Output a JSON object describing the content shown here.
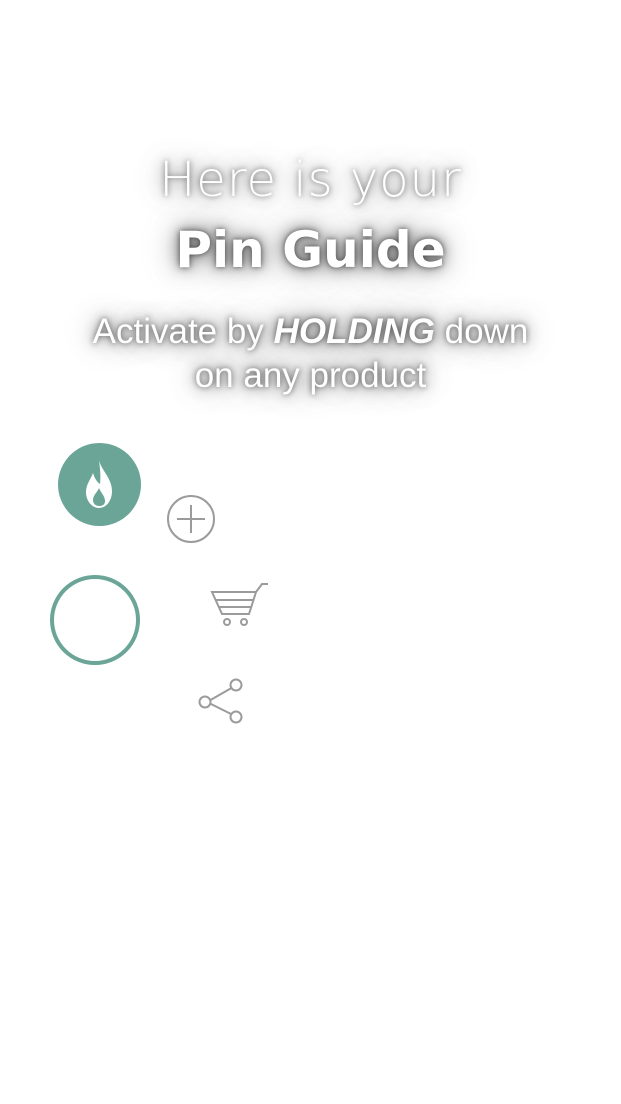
{
  "guide": {
    "title_line1": "Here is your",
    "title_line2": "Pin Guide",
    "instruction_prefix": "Activate by ",
    "instruction_emphasis": "HOLDING",
    "instruction_suffix": " down",
    "instruction_line2": "on any product"
  },
  "pin_menu": {
    "hot_button_icon": "fire-icon",
    "pin_target_icon": "ring-icon",
    "actions": [
      {
        "name": "add",
        "icon": "plus-icon"
      },
      {
        "name": "cart",
        "icon": "cart-icon"
      },
      {
        "name": "share",
        "icon": "share-icon"
      }
    ]
  },
  "colors": {
    "accent": "#6aa598",
    "icon_gray": "#9b9b9b",
    "text": "#ffffff",
    "background": "#ffffff"
  }
}
